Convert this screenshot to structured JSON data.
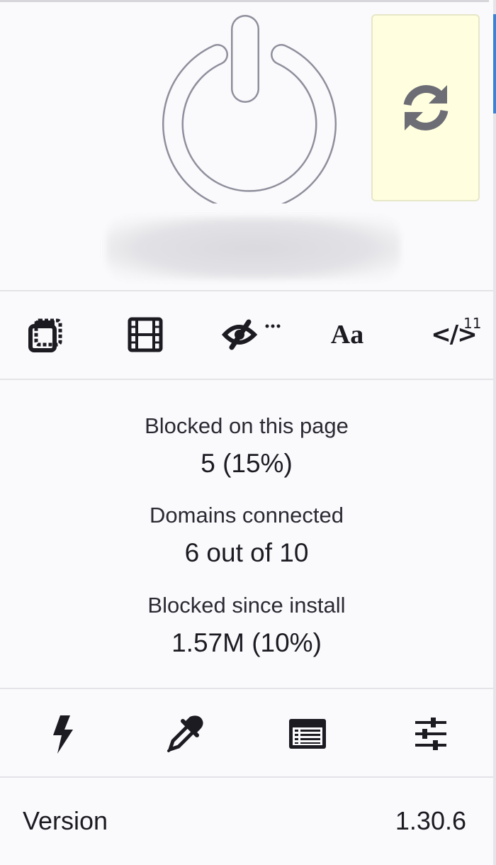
{
  "hero": {
    "power_icon": "power-icon",
    "refresh_icon": "refresh-icon",
    "hostname": "",
    "refresh_bg": "#ffffe0"
  },
  "toolbar": {
    "items": [
      {
        "icon": "popup-block-icon"
      },
      {
        "icon": "media-block-icon"
      },
      {
        "icon": "cosmetic-filter-icon"
      },
      {
        "icon": "font-icon",
        "glyph": "Aa"
      },
      {
        "icon": "script-icon",
        "glyph": "</>",
        "badge": "11"
      }
    ]
  },
  "stats": {
    "blocked_page_label": "Blocked on this page",
    "blocked_page_value": "5 (15%)",
    "domains_label": "Domains connected",
    "domains_value": "6 out of 10",
    "blocked_install_label": "Blocked since install",
    "blocked_install_value": "1.57M (10%)"
  },
  "tools": [
    {
      "icon": "lightning-icon"
    },
    {
      "icon": "eyedropper-icon"
    },
    {
      "icon": "logger-icon"
    },
    {
      "icon": "settings-sliders-icon"
    }
  ],
  "footer": {
    "version_label": "Version",
    "version_value": "1.30.6"
  }
}
